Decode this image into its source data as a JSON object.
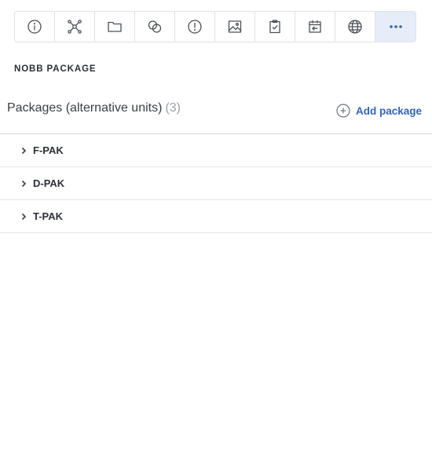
{
  "toolbar": {
    "buttons": [
      {
        "icon": "info-icon"
      },
      {
        "icon": "network-icon"
      },
      {
        "icon": "folder-icon"
      },
      {
        "icon": "link-circles-icon"
      },
      {
        "icon": "alert-icon"
      },
      {
        "icon": "image-icon"
      },
      {
        "icon": "clipboard-check-icon"
      },
      {
        "icon": "calendar-import-icon"
      },
      {
        "icon": "globe-icon"
      },
      {
        "icon": "more-icon",
        "active": true
      }
    ],
    "active_color": "#e6edf9"
  },
  "section": {
    "title": "NOBB PACKAGE"
  },
  "packages": {
    "heading": "Packages (alternative units)",
    "count": "(3)",
    "add_label": "Add package",
    "items": [
      {
        "name": "F-PAK"
      },
      {
        "name": "D-PAK"
      },
      {
        "name": "T-PAK"
      }
    ]
  },
  "colors": {
    "accent": "#2f63c4",
    "muted": "#9aa0a8"
  }
}
